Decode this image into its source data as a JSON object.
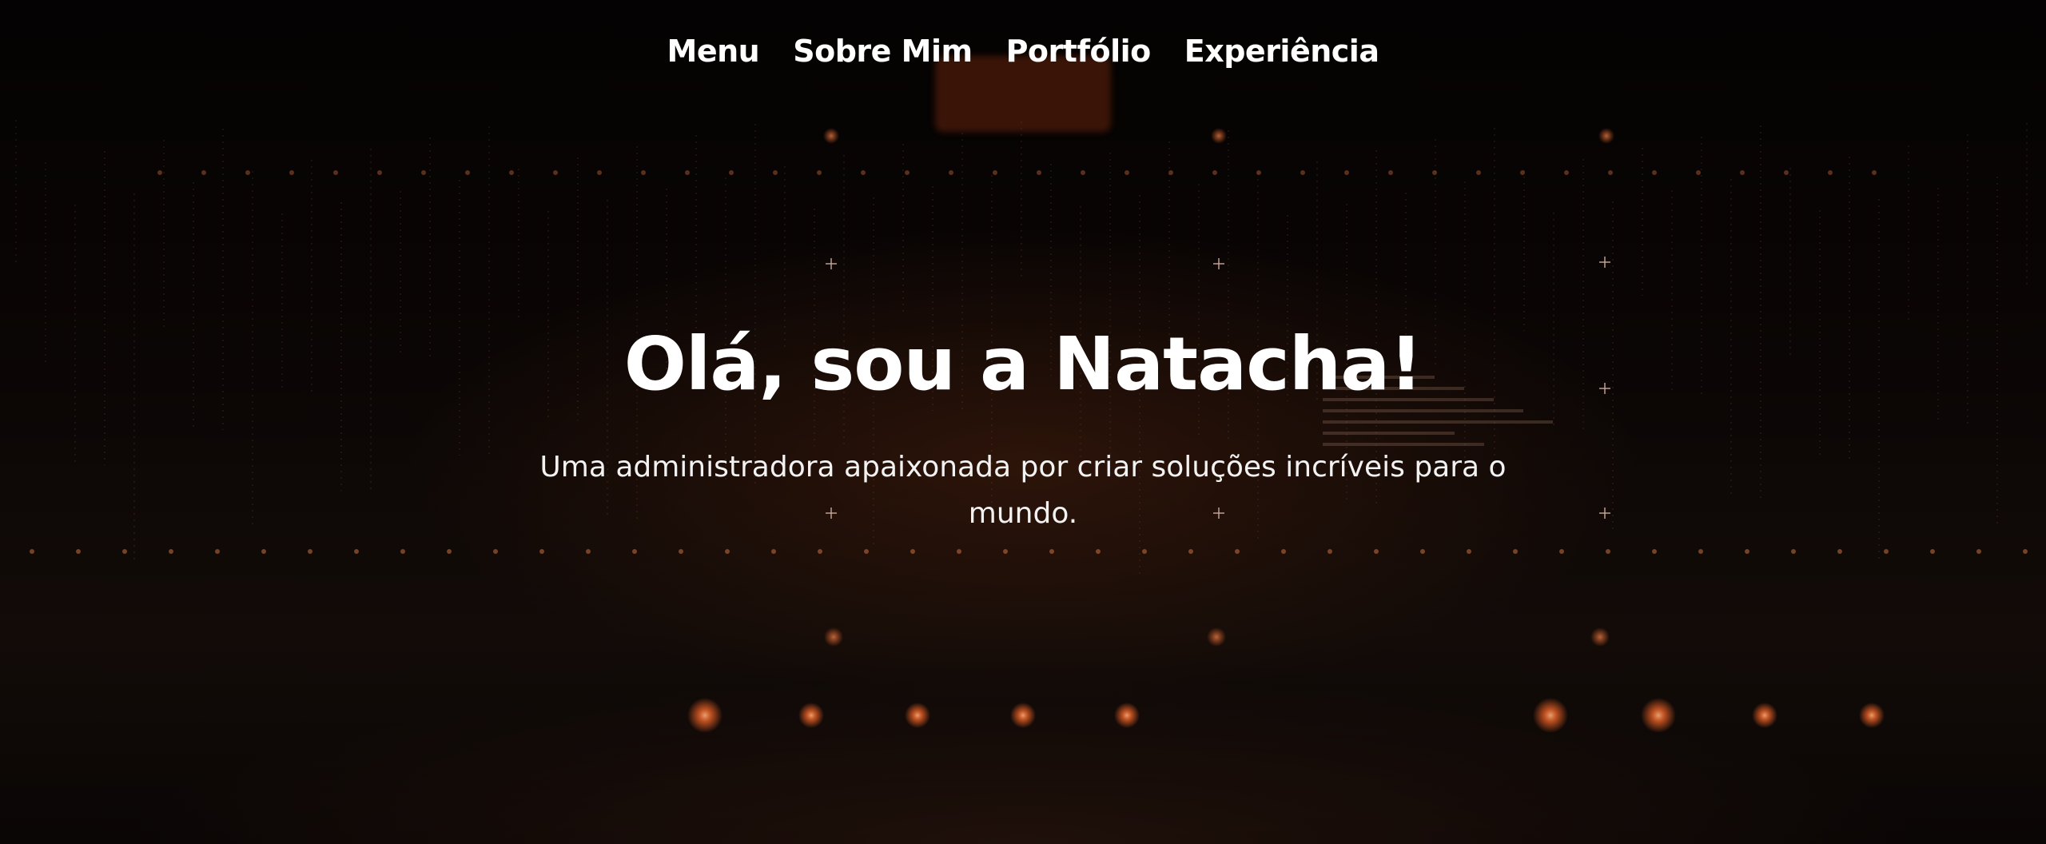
{
  "nav": {
    "items": [
      {
        "label": "Menu"
      },
      {
        "label": "Sobre Mim"
      },
      {
        "label": "Portfólio"
      },
      {
        "label": "Experiência"
      }
    ]
  },
  "hero": {
    "title": "Olá, sou a Natacha!",
    "subtitle": "Uma administradora apaixonada por criar soluções incríveis para o mundo."
  },
  "colors": {
    "text": "#ffffff",
    "background": "#050303",
    "accent_glow": "#ff6a2a"
  }
}
